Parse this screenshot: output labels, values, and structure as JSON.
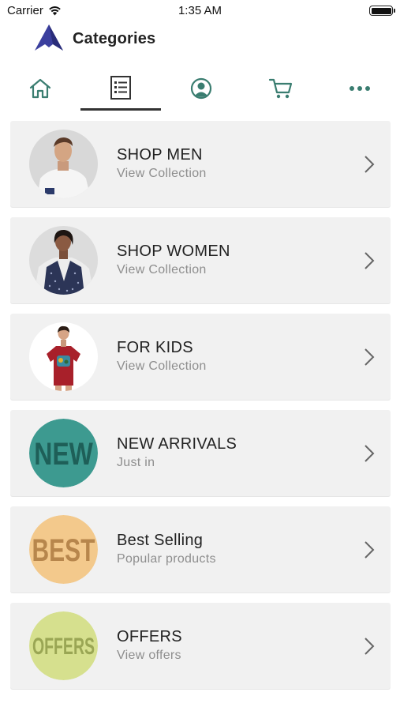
{
  "status_bar": {
    "carrier": "Carrier",
    "time": "1:35 AM"
  },
  "header": {
    "title": "Categories"
  },
  "nav_tabs": [
    {
      "icon": "home-icon"
    },
    {
      "icon": "list-icon",
      "active": true
    },
    {
      "icon": "account-icon"
    },
    {
      "icon": "cart-icon"
    },
    {
      "icon": "more-icon"
    }
  ],
  "categories": [
    {
      "title": "SHOP MEN",
      "subtitle": "View Collection",
      "image": "man-in-white-tee"
    },
    {
      "title": "SHOP WOMEN",
      "subtitle": "View Collection",
      "image": "woman-in-blue-top"
    },
    {
      "title": "FOR KIDS",
      "subtitle": "View Collection",
      "image": "kid-in-red-tee"
    },
    {
      "title": "NEW ARRIVALS",
      "subtitle": "Just in",
      "image": "badge",
      "badge_text": "NEW",
      "badge_bg": "#3d9a90",
      "badge_fg": "#1e5f58"
    },
    {
      "title": "Best Selling",
      "subtitle": "Popular products",
      "image": "badge",
      "badge_text": "BEST",
      "badge_bg": "#f3c98c",
      "badge_fg": "#b7864c"
    },
    {
      "title": "OFFERS",
      "subtitle": "View offers",
      "image": "badge",
      "badge_text": "OFFERS",
      "badge_bg": "#d6e08e",
      "badge_fg": "#9aa654"
    }
  ],
  "colors": {
    "accent": "#3a7d70",
    "card_bg": "#f1f1f1",
    "logo": "#3b3f9e"
  }
}
